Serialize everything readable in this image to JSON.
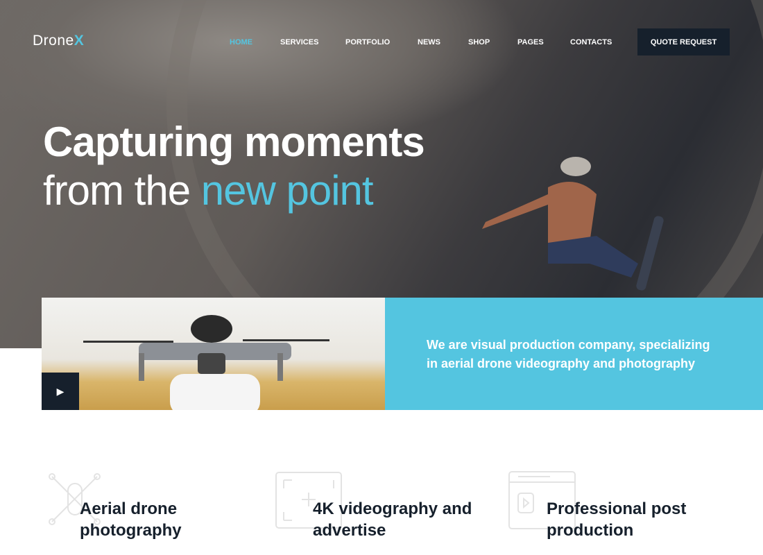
{
  "header": {
    "logo_text": "Drone",
    "logo_accent": "X",
    "nav": [
      "HOME",
      "SERVICES",
      "PORTFOLIO",
      "NEWS",
      "SHOP",
      "PAGES",
      "CONTACTS"
    ],
    "active_nav": "HOME",
    "quote_label": "QUOTE REQUEST"
  },
  "hero": {
    "line1": "Capturing moments",
    "line2_light": "from the ",
    "line2_accent": "new point"
  },
  "intro": {
    "text": "We are visual production company, specializing in aerial drone videography and photography",
    "play_icon": "play-icon"
  },
  "features": [
    {
      "title": "Aerial drone photography",
      "icon": "drone-icon"
    },
    {
      "title": "4K videography and advertise",
      "icon": "video-frame-icon"
    },
    {
      "title": "Professional post production",
      "icon": "video-player-icon"
    }
  ],
  "colors": {
    "accent": "#54c5e0",
    "dark": "#16202c"
  }
}
